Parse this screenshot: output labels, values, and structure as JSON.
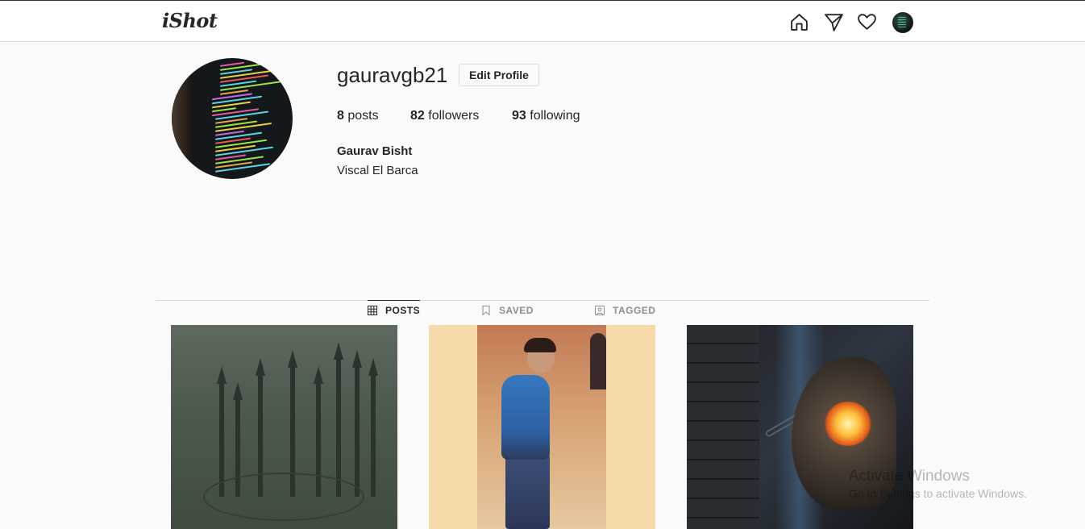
{
  "header": {
    "logo": "iShot",
    "icons": [
      "home-icon",
      "send-icon",
      "heart-icon",
      "profile-avatar"
    ]
  },
  "profile": {
    "username": "gauravgb21",
    "edit_button": "Edit Profile",
    "stats": {
      "posts_count": "8",
      "posts_label": "posts",
      "followers_count": "82",
      "followers_label": "followers",
      "following_count": "93",
      "following_label": "following"
    },
    "full_name": "Gaurav Bisht",
    "bio": "Viscal El Barca"
  },
  "tabs": [
    {
      "label": "POSTS",
      "icon": "grid-icon",
      "active": true
    },
    {
      "label": "SAVED",
      "icon": "bookmark-icon",
      "active": false
    },
    {
      "label": "TAGGED",
      "icon": "tag-icon",
      "active": false
    }
  ],
  "watermark": {
    "title": "Activate Windows",
    "subtitle": "Go to Settings to activate Windows."
  },
  "colors": {
    "background": "#fafafa",
    "text": "#262626",
    "muted": "#8e8e8e",
    "border": "#dbdbdb"
  }
}
